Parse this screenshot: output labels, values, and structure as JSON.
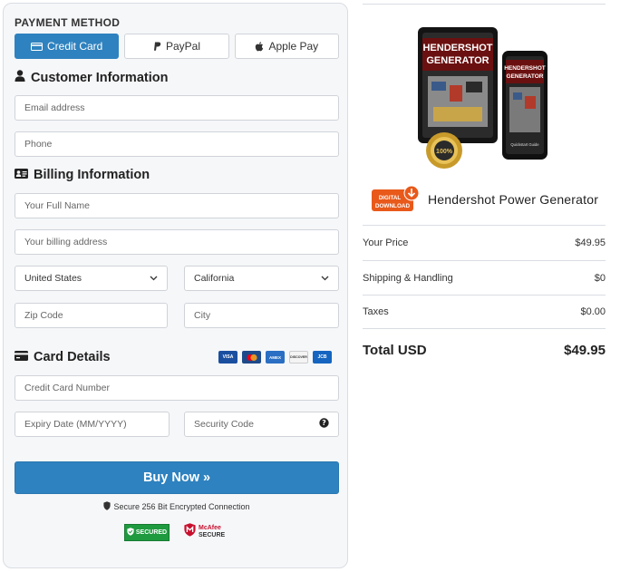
{
  "payment": {
    "section_label": "PAYMENT METHOD",
    "tabs": [
      {
        "label": "Credit Card",
        "icon": "credit-card-icon",
        "active": true
      },
      {
        "label": "PayPal",
        "icon": "paypal-icon",
        "active": false
      },
      {
        "label": "Apple Pay",
        "icon": "apple-icon",
        "active": false
      }
    ]
  },
  "customer": {
    "heading": "Customer Information",
    "email_placeholder": "Email address",
    "phone_placeholder": "Phone"
  },
  "billing": {
    "heading": "Billing Information",
    "name_placeholder": "Your Full Name",
    "address_placeholder": "Your billing address",
    "country_value": "United States",
    "state_value": "California",
    "zip_placeholder": "Zip Code",
    "city_placeholder": "City"
  },
  "card": {
    "heading": "Card Details",
    "logos": [
      "VISA",
      "mastercard",
      "AMEX",
      "DISCOVER",
      "JCB"
    ],
    "number_placeholder": "Credit Card Number",
    "expiry_placeholder": "Expiry Date (MM/YYYY)",
    "cvv_placeholder": "Security Code"
  },
  "buy_button": "Buy Now »",
  "secure_text": "Secure 256 Bit Encrypted Connection",
  "badges": {
    "secured": "SECURED",
    "mcafee_line1": "McAfee",
    "mcafee_line2": "SECURE"
  },
  "product": {
    "name": "Hendershot Power Generator",
    "image_title": "HENDERSHOT GENERATOR",
    "badge_line1": "DIGITAL",
    "badge_line2": "DOWNLOAD",
    "guide_label": "Quickstart Guide",
    "seal_text": "100%"
  },
  "summary": {
    "rows": [
      {
        "label": "Your Price",
        "value": "$49.95"
      },
      {
        "label": "Shipping & Handling",
        "value": "$0"
      },
      {
        "label": "Taxes",
        "value": "$0.00"
      }
    ],
    "total_label": "Total USD",
    "total_value": "$49.95"
  },
  "colors": {
    "accent": "#2e82bf",
    "panel_bg": "#f6f7f9",
    "border": "#cfd3d8",
    "badge_orange": "#e8591a"
  }
}
